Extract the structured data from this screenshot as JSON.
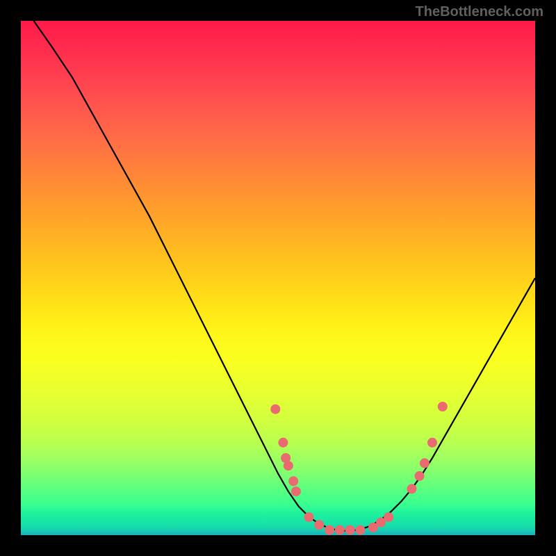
{
  "watermark": "TheBottleneck.com",
  "chart_data": {
    "type": "line",
    "title": "",
    "xlabel": "",
    "ylabel": "",
    "xlim": [
      0,
      100
    ],
    "ylim": [
      0,
      100
    ],
    "curve": [
      {
        "x": 2.5,
        "y": 100
      },
      {
        "x": 6,
        "y": 95
      },
      {
        "x": 10,
        "y": 89
      },
      {
        "x": 15,
        "y": 80
      },
      {
        "x": 20,
        "y": 71
      },
      {
        "x": 25,
        "y": 62
      },
      {
        "x": 30,
        "y": 52
      },
      {
        "x": 35,
        "y": 42
      },
      {
        "x": 40,
        "y": 32
      },
      {
        "x": 45,
        "y": 22
      },
      {
        "x": 48,
        "y": 16
      },
      {
        "x": 50,
        "y": 12
      },
      {
        "x": 52,
        "y": 8.5
      },
      {
        "x": 54,
        "y": 5.6
      },
      {
        "x": 56,
        "y": 3.6
      },
      {
        "x": 58,
        "y": 2.2
      },
      {
        "x": 60,
        "y": 1.3
      },
      {
        "x": 62,
        "y": 0.9
      },
      {
        "x": 64,
        "y": 0.8
      },
      {
        "x": 66,
        "y": 1.1
      },
      {
        "x": 68,
        "y": 1.8
      },
      {
        "x": 70,
        "y": 3.0
      },
      {
        "x": 72,
        "y": 4.6
      },
      {
        "x": 74,
        "y": 6.6
      },
      {
        "x": 76,
        "y": 9.0
      },
      {
        "x": 78,
        "y": 11.8
      },
      {
        "x": 80,
        "y": 15
      },
      {
        "x": 84,
        "y": 22
      },
      {
        "x": 88,
        "y": 29
      },
      {
        "x": 92,
        "y": 36
      },
      {
        "x": 96,
        "y": 43
      },
      {
        "x": 100,
        "y": 50
      }
    ],
    "points": [
      {
        "x": 49.5,
        "y": 24.5
      },
      {
        "x": 51.0,
        "y": 18.0
      },
      {
        "x": 51.5,
        "y": 15.0
      },
      {
        "x": 52.0,
        "y": 13.5
      },
      {
        "x": 53.0,
        "y": 10.5
      },
      {
        "x": 53.5,
        "y": 8.5
      },
      {
        "x": 56.0,
        "y": 3.5
      },
      {
        "x": 58.0,
        "y": 2.0
      },
      {
        "x": 60.0,
        "y": 1.0
      },
      {
        "x": 62.0,
        "y": 1.0
      },
      {
        "x": 64.0,
        "y": 1.0
      },
      {
        "x": 66.0,
        "y": 1.0
      },
      {
        "x": 68.5,
        "y": 1.5
      },
      {
        "x": 70.0,
        "y": 2.5
      },
      {
        "x": 71.5,
        "y": 3.5
      },
      {
        "x": 76.0,
        "y": 9.0
      },
      {
        "x": 77.5,
        "y": 11.5
      },
      {
        "x": 78.5,
        "y": 14.0
      },
      {
        "x": 80.0,
        "y": 18.0
      },
      {
        "x": 82.0,
        "y": 25.0
      }
    ],
    "point_color": "#e96a6f",
    "curve_color": "#000000"
  }
}
